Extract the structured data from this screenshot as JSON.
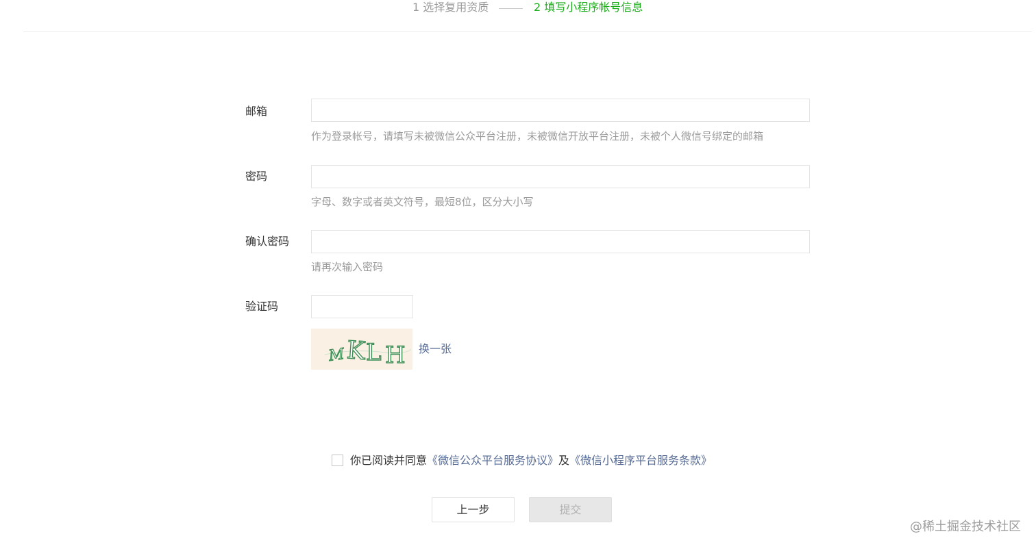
{
  "steps": {
    "step1": "1 选择复用资质",
    "step2": "2 填写小程序帐号信息"
  },
  "form": {
    "email": {
      "label": "邮箱",
      "value": "",
      "tip": "作为登录帐号，请填写未被微信公众平台注册，未被微信开放平台注册，未被个人微信号绑定的邮箱"
    },
    "password": {
      "label": "密码",
      "value": "",
      "tip": "字母、数字或者英文符号，最短8位，区分大小写"
    },
    "confirm_password": {
      "label": "确认密码",
      "value": "",
      "tip": "请再次输入密码"
    },
    "captcha": {
      "label": "验证码",
      "value": "",
      "image_text": "MKLH",
      "refresh_label": "换一张"
    }
  },
  "agreement": {
    "checked": false,
    "prefix": "你已阅读并同意",
    "link1": "《微信公众平台服务协议》",
    "joiner": "及",
    "link2": "《微信小程序平台服务条款》"
  },
  "buttons": {
    "prev": "上一步",
    "submit": "提交"
  },
  "watermark": "@稀土掘金技术社区",
  "colors": {
    "accent_green": "#1aad19",
    "link_blue": "#576b95",
    "tip_gray": "#9a9a9a"
  }
}
